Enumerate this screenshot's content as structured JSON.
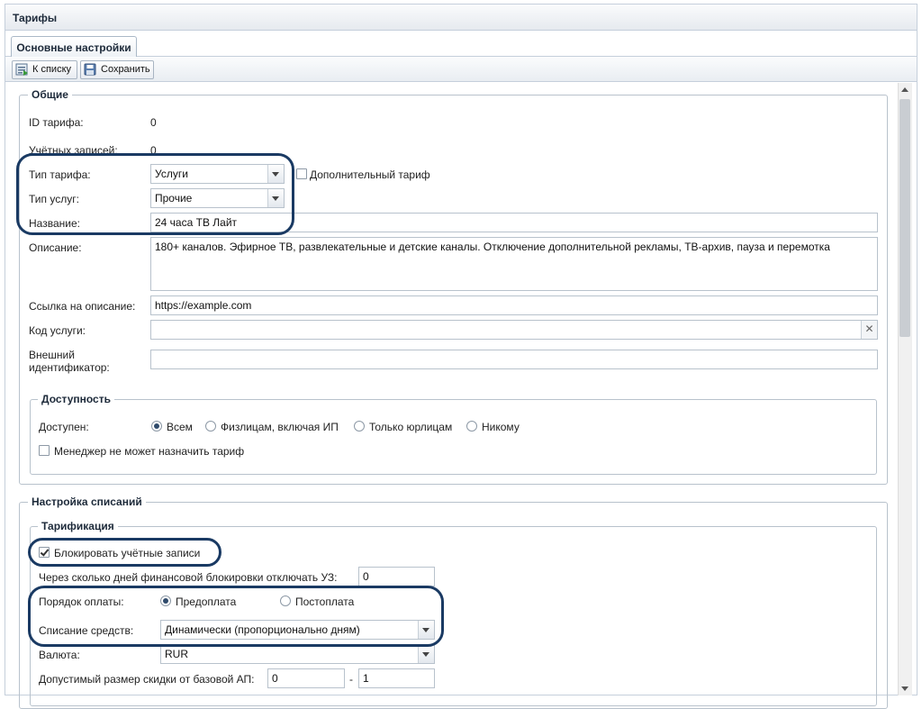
{
  "window": {
    "title": "Тарифы"
  },
  "tabs": [
    {
      "label": "Основные настройки",
      "active": true
    }
  ],
  "toolbar": {
    "to_list": "К списку",
    "save": "Сохранить"
  },
  "general": {
    "legend": "Общие",
    "tariff_id_label": "ID тарифа:",
    "tariff_id_value": "0",
    "accounts_label": "Учётных записей:",
    "accounts_value": "0",
    "tariff_type_label": "Тип тарифа:",
    "tariff_type_value": "Услуги",
    "additional_tariff_label": "Дополнительный тариф",
    "additional_tariff_checked": false,
    "service_type_label": "Тип услуг:",
    "service_type_value": "Прочие",
    "name_label": "Название:",
    "name_value": "24 часа ТВ Лайт",
    "description_label": "Описание:",
    "description_value": "180+ каналов. Эфирное ТВ, развлекательные и детские каналы. Отключение дополнительной рекламы, ТВ-архив, пауза и перемотка",
    "link_label": "Ссылка на описание:",
    "link_value": "https://example.com",
    "service_code_label": "Код услуги:",
    "service_code_value": "",
    "external_id_label_1": "Внешний",
    "external_id_label_2": "идентификатор:",
    "external_id_value": ""
  },
  "availability": {
    "legend": "Доступность",
    "available_label": "Доступен:",
    "options": [
      "Всем",
      "Физлицам, включая ИП",
      "Только юрлицам",
      "Никому"
    ],
    "selected": "Всем",
    "manager_cannot_assign_label": "Менеджер не может назначить тариф",
    "manager_cannot_assign_checked": false
  },
  "charges": {
    "legend": "Настройка списаний",
    "tariffing_legend": "Тарификация",
    "block_accounts_label": "Блокировать учётные записи",
    "block_accounts_checked": true,
    "days_label": "Через сколько дней финансовой блокировки отключать УЗ:",
    "days_value": "0",
    "payment_order_label": "Порядок оплаты:",
    "payment_options": [
      "Предоплата",
      "Постоплата"
    ],
    "payment_selected": "Предоплата",
    "write_off_label": "Списание средств:",
    "write_off_value": "Динамически (пропорционально дням)",
    "currency_label": "Валюта:",
    "currency_value": "RUR",
    "discount_label": "Допустимый размер скидки от базовой АП:",
    "discount_from": "0",
    "discount_sep": "-",
    "discount_to": "1"
  },
  "colors": {
    "highlight": "#1a3a63",
    "border": "#b8c2cc",
    "header": "#1d2a3a"
  }
}
